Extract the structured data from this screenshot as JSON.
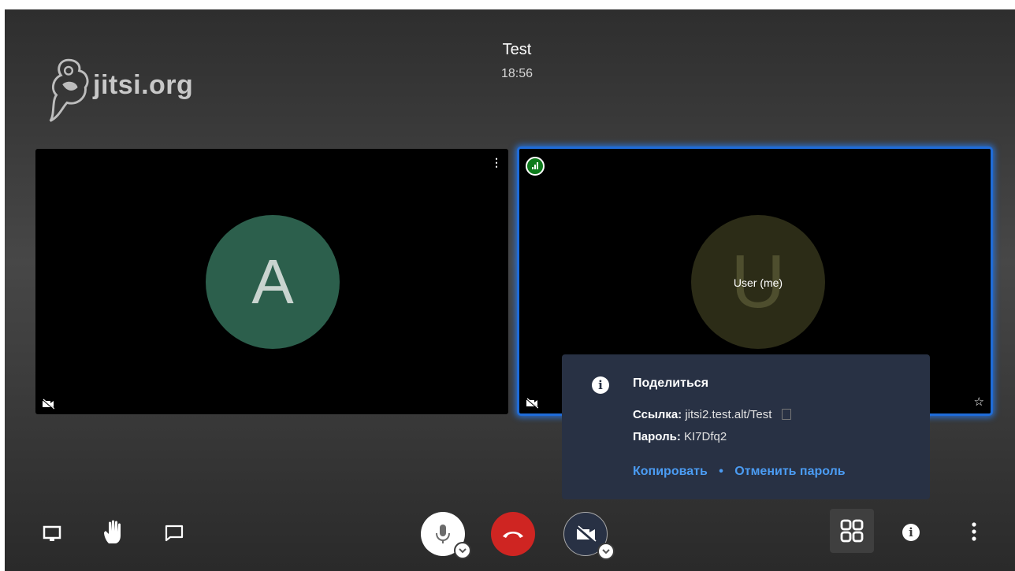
{
  "header": {
    "title": "Test",
    "time": "18:56"
  },
  "logo": {
    "text": "jitsi.org"
  },
  "participants": [
    {
      "initial": "A",
      "color": "#2c5f4c"
    },
    {
      "initial": "U",
      "color": "#2c2c17",
      "label": "User (me)"
    }
  ],
  "share_popup": {
    "title": "Поделиться",
    "link_label": "Ссылка:",
    "link_value": "jitsi2.test.alt/Test",
    "password_label": "Пароль:",
    "password_value": "KI7Dfq2",
    "copy_action": "Копировать",
    "cancel_password_action": "Отменить пароль"
  },
  "toolbar": {
    "left": [
      "desktop-icon",
      "raise-hand-icon",
      "chat-icon"
    ],
    "center": [
      "microphone-icon",
      "hangup-icon",
      "camera-off-icon"
    ],
    "right": [
      "tile-view-icon",
      "info-icon",
      "more-icon"
    ]
  },
  "colors": {
    "accent": "#4b9cf3",
    "hangup": "#cf2522",
    "highlight": "#1f6cd8",
    "popup_bg": "#283144"
  }
}
